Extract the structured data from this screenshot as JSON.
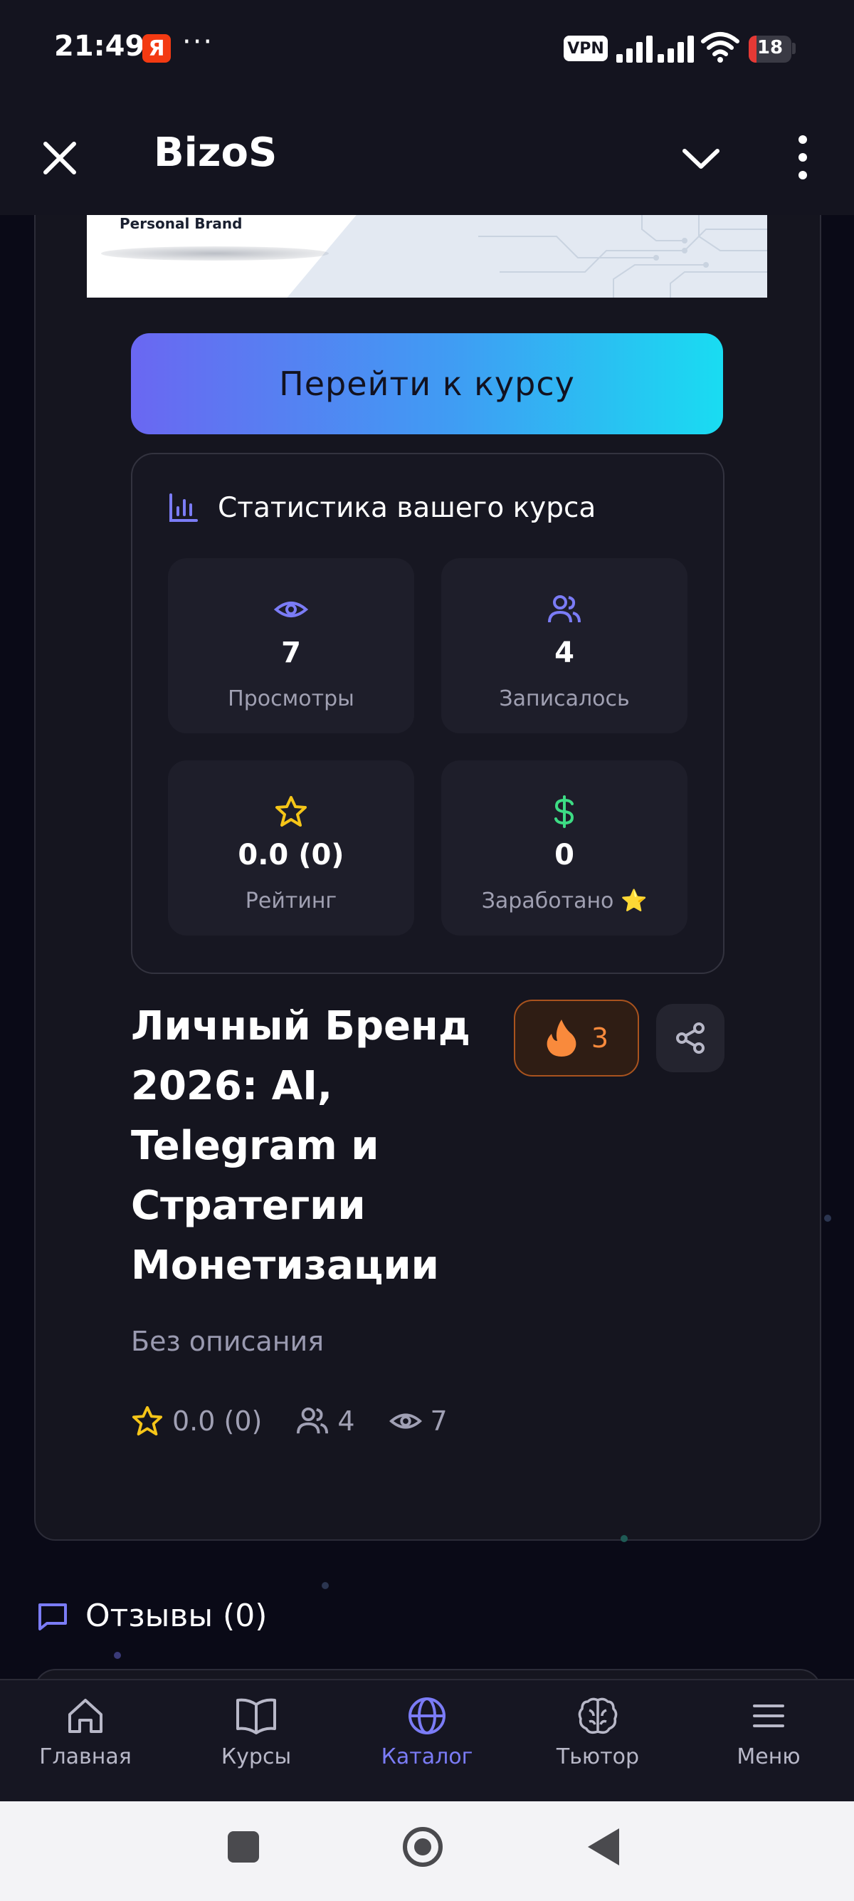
{
  "status_bar": {
    "time": "21:49",
    "ya_badge": "Я",
    "dots": "···",
    "vpn": "VPN",
    "battery": "18",
    "battery_level_percent": 18
  },
  "header": {
    "title": "BizoS",
    "close_icon": "close-icon",
    "dropdown_icon": "chevron-down-icon",
    "more_icon": "more-vertical-icon"
  },
  "banner": {
    "text": "Personal Brand"
  },
  "course": {
    "cta_label": "Перейти к курсу",
    "title": "Личный Бренд 2026: AI, Telegram и Стратегии Монетизации",
    "fire_count": "3",
    "description": "Без описания",
    "meta": {
      "rating": "0.0 (0)",
      "students": "4",
      "views": "7"
    }
  },
  "stats": {
    "heading": "Статистика вашего курса",
    "tiles": [
      {
        "value": "7",
        "caption": "Просмотры",
        "icon": "eye-icon"
      },
      {
        "value": "4",
        "caption": "Записалось",
        "icon": "users-icon"
      },
      {
        "value": "0.0 (0)",
        "caption": "Рейтинг",
        "icon": "star-icon"
      },
      {
        "value": "0",
        "caption": "Заработано ⭐",
        "icon": "dollar-icon"
      }
    ]
  },
  "reviews": {
    "label": "Отзывы (0)"
  },
  "bottom_nav": [
    {
      "label": "Главная",
      "icon": "home-icon",
      "active": false
    },
    {
      "label": "Курсы",
      "icon": "book-icon",
      "active": false
    },
    {
      "label": "Каталог",
      "icon": "globe-icon",
      "active": true
    },
    {
      "label": "Тьютор",
      "icon": "brain-icon",
      "active": false
    },
    {
      "label": "Меню",
      "icon": "menu-icon",
      "active": false
    }
  ],
  "colors": {
    "accent": "#7b7cf6",
    "cta_gradient_start": "#6a67f2",
    "cta_gradient_end": "#19dcf2",
    "fire": "#f98a3c",
    "star": "#f5c518",
    "money": "#3ddc84",
    "battery": "#e53935"
  }
}
